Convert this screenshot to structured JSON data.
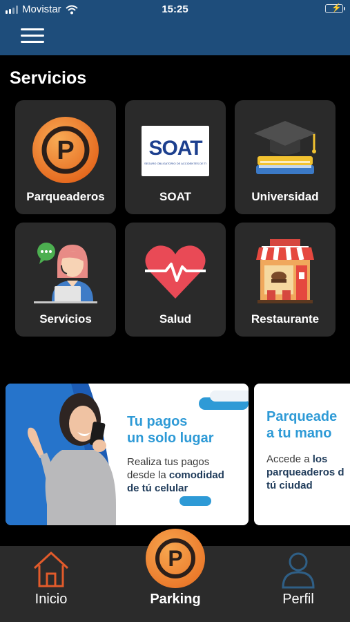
{
  "status_bar": {
    "carrier": "Movistar",
    "time": "15:25"
  },
  "header": {
    "menu_icon": "hamburger-menu-icon"
  },
  "section": {
    "title": "Servicios"
  },
  "services": [
    {
      "label": "Parqueaderos",
      "icon": "parking-icon"
    },
    {
      "label": "SOAT",
      "icon": "soat-logo",
      "logo_text": "SOAT",
      "logo_subtext": "SEGURO OBLIGATORIO DE ACCIDENTES DE TRÁNSITO"
    },
    {
      "label": "Universidad",
      "icon": "graduation-cap-icon"
    },
    {
      "label": "Servicios",
      "icon": "support-agent-icon"
    },
    {
      "label": "Salud",
      "icon": "heart-pulse-icon"
    },
    {
      "label": "Restaurante",
      "icon": "restaurant-icon"
    }
  ],
  "banners": [
    {
      "title_line1": "Tu pagos",
      "title_line2": "un solo lugar",
      "text_line1": "Realiza tus pagos",
      "text_line2_plain": "desde la ",
      "text_line2_bold": "comodidad",
      "text_line3_bold": "de tú celular"
    },
    {
      "title_line1": "Parqueade",
      "title_line2": "a tu mano",
      "text_line1_plain": "Accede a ",
      "text_line1_bold": "los",
      "text_line2_bold": "parqueaderos d",
      "text_line3_bold": "tú ciudad"
    }
  ],
  "bottom_nav": {
    "home_label": "Inicio",
    "parking_label": "Parking",
    "profile_label": "Perfil"
  },
  "colors": {
    "header_bg": "#1e4d7b",
    "accent_orange": "#ee7a26",
    "banner_blue": "#2e9ad6",
    "card_bg": "#2a2a2a",
    "profile_icon": "#2f5f86"
  }
}
